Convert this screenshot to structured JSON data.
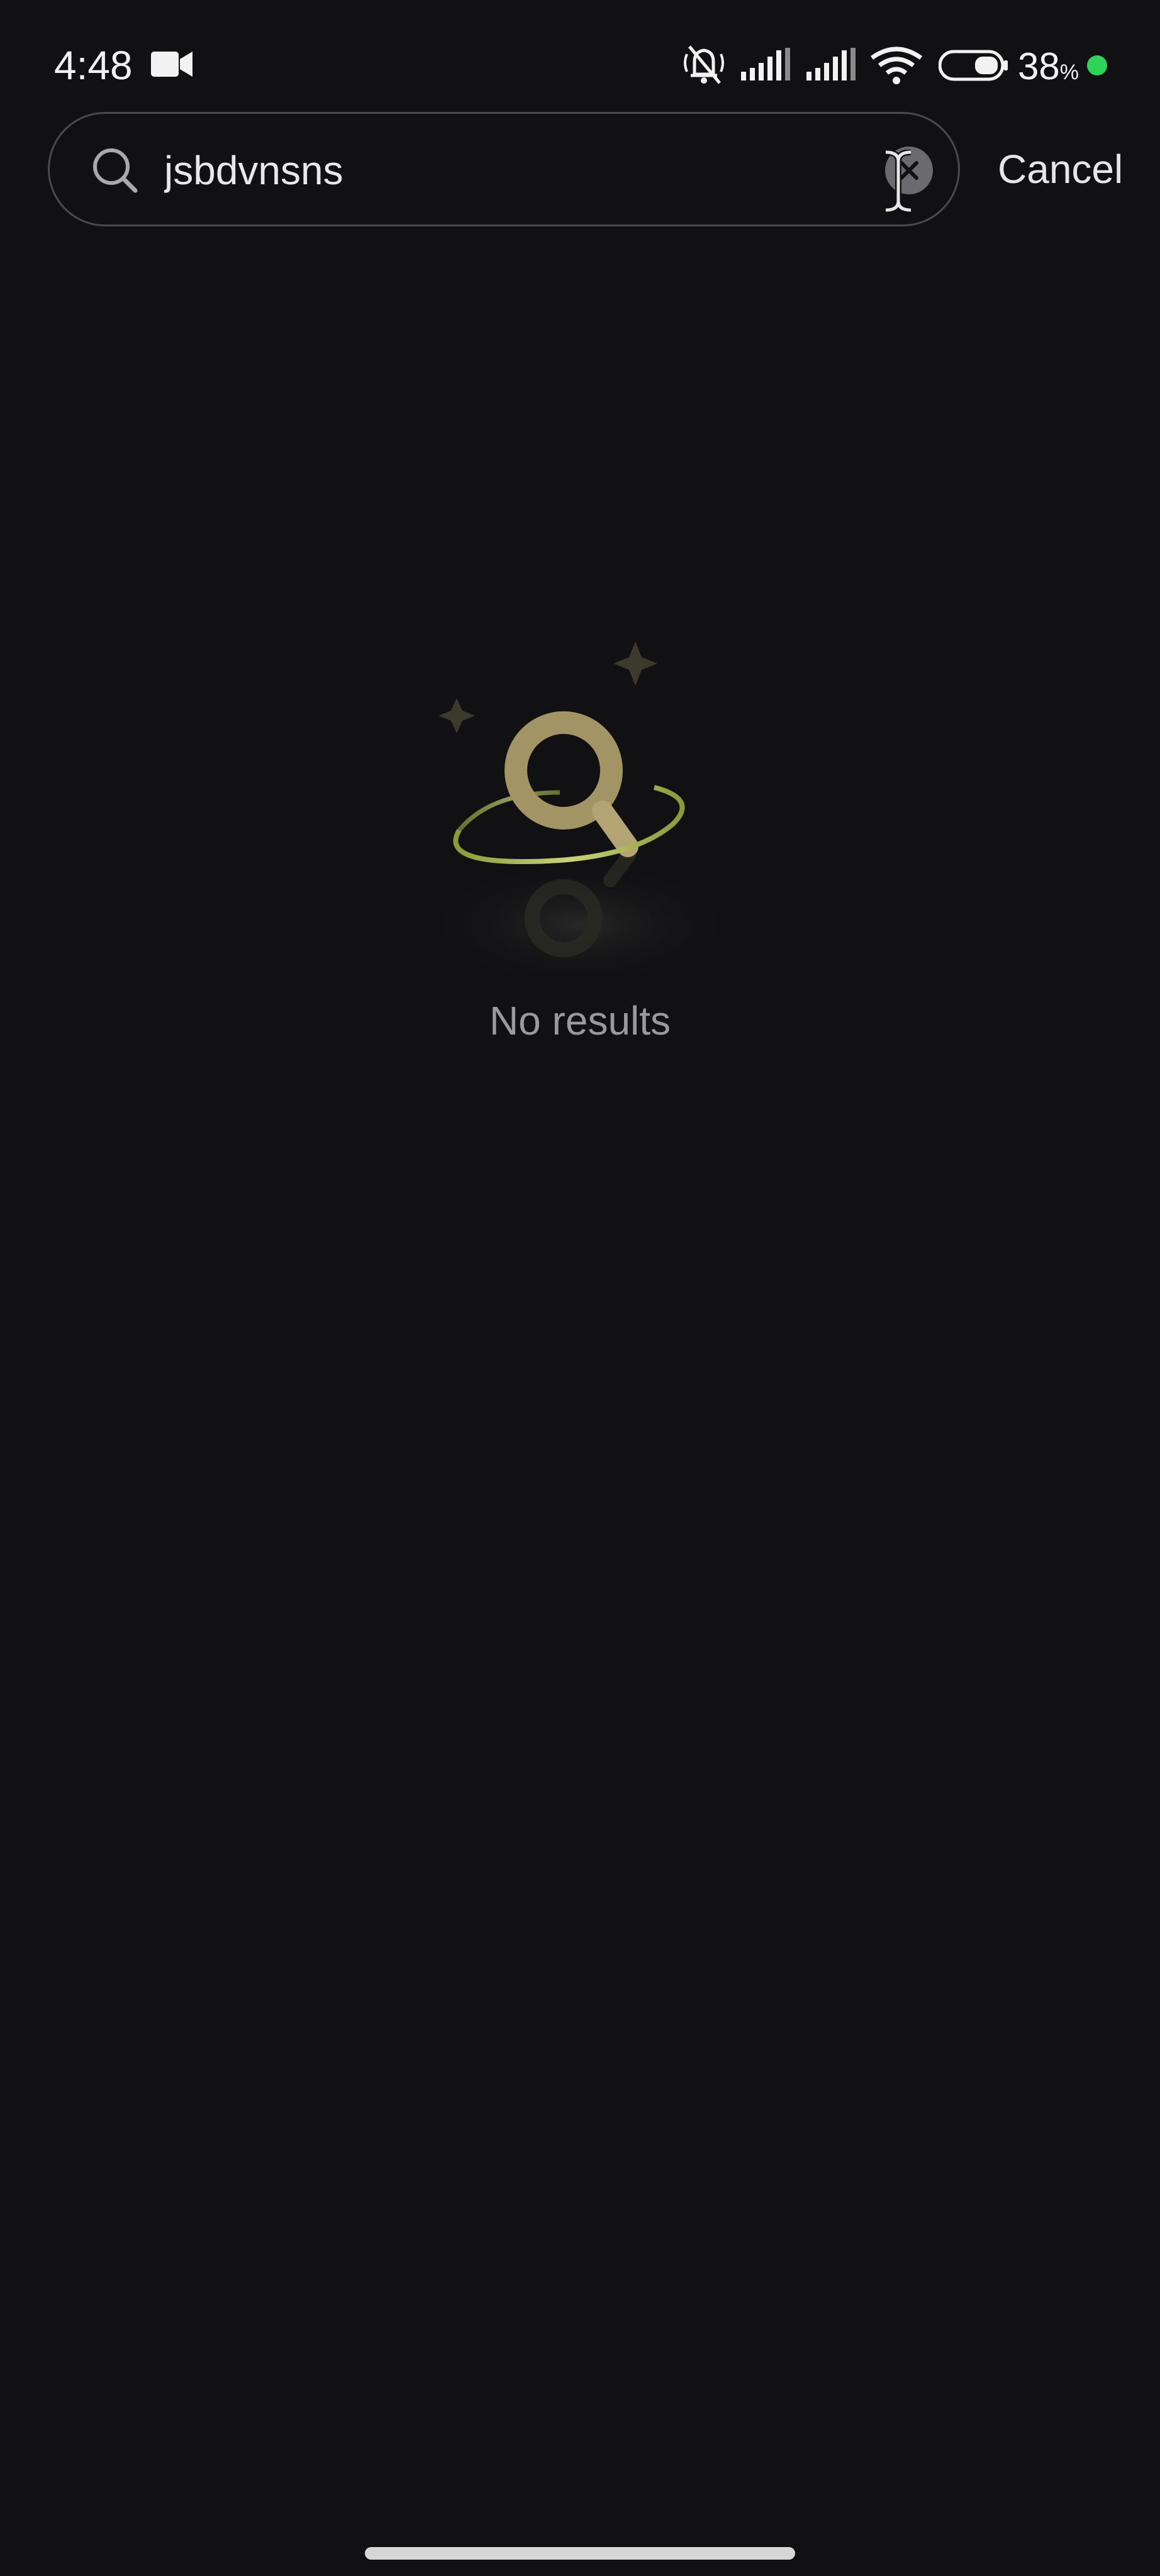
{
  "status_bar": {
    "time": "4:48",
    "battery": "38",
    "battery_unit": "%",
    "icons": [
      "video-camera-icon",
      "mute-bell-icon",
      "signal-icon",
      "signal-icon",
      "wifi-icon",
      "battery-icon",
      "green-dot-icon"
    ],
    "dot_color": "#2fd35a"
  },
  "search": {
    "query": "jsbdvnsns",
    "cancel_label": "Cancel"
  },
  "empty_state": {
    "message": "No results",
    "illustration_icon": "magnifier-with-orbit-icon",
    "accent_color": "#a39466"
  }
}
